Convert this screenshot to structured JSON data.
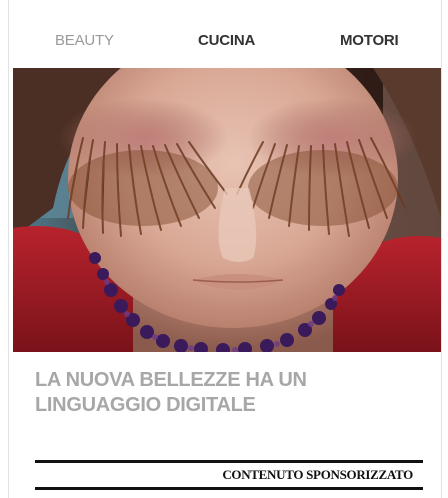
{
  "tabs": [
    {
      "label": "BEAUTY",
      "active": true
    },
    {
      "label": "CUCINA",
      "active": false
    },
    {
      "label": "MOTORI",
      "active": false
    }
  ],
  "article": {
    "headline": "LA NUOVA BELLEZZE HA UN LINGUAGGIO DIGITALE",
    "image": "close-up of a face with long feather eyelashes and a beaded necklace"
  },
  "footer": {
    "sponsored_label": "CONTENUTO SPONSORIZZATO"
  },
  "colors": {
    "active_tab": "#9a9a9a",
    "inactive_tab": "#333333",
    "headline": "#a7a7a7",
    "rules": "#111111"
  }
}
